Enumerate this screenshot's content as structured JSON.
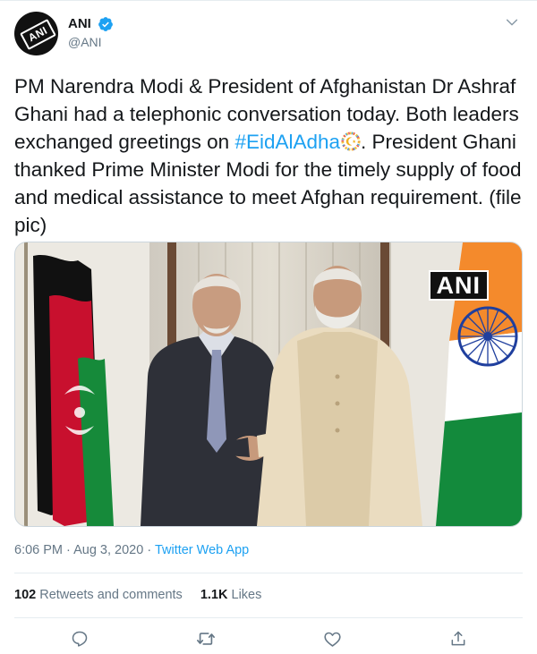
{
  "author": {
    "display_name": "ANI",
    "handle": "@ANI",
    "avatar_text": "ANI",
    "verified": true,
    "verified_color": "#1da1f2"
  },
  "tweet": {
    "text_part1": "PM Narendra Modi & President of Afghanistan Dr Ashraf Ghani had a telephonic conversation today. Both leaders exchanged greetings on ",
    "hashtag": "#EidAlAdha",
    "text_part2": ". President Ghani thanked Prime Minister Modi for the timely supply of food and medical assistance to meet Afghan requirement. (file pic)",
    "emoji": "crescent-moon-star-emoji",
    "media_watermark": "ANI",
    "media_description_icon": "photo"
  },
  "meta": {
    "time": "6:06 PM",
    "separator": " · ",
    "date": "Aug 3, 2020",
    "source": "Twitter Web App"
  },
  "stats": {
    "retweets_count": "102",
    "retweets_label": "Retweets and comments",
    "likes_count": "1.1K",
    "likes_label": "Likes"
  },
  "actions": [
    {
      "name": "reply",
      "icon": "reply-icon"
    },
    {
      "name": "retweet",
      "icon": "retweet-icon"
    },
    {
      "name": "like",
      "icon": "heart-icon"
    },
    {
      "name": "share",
      "icon": "share-icon"
    }
  ],
  "colors": {
    "link": "#1da1f2",
    "secondary_text": "#657786",
    "primary_text": "#14171a",
    "border": "#e6ecf0"
  }
}
